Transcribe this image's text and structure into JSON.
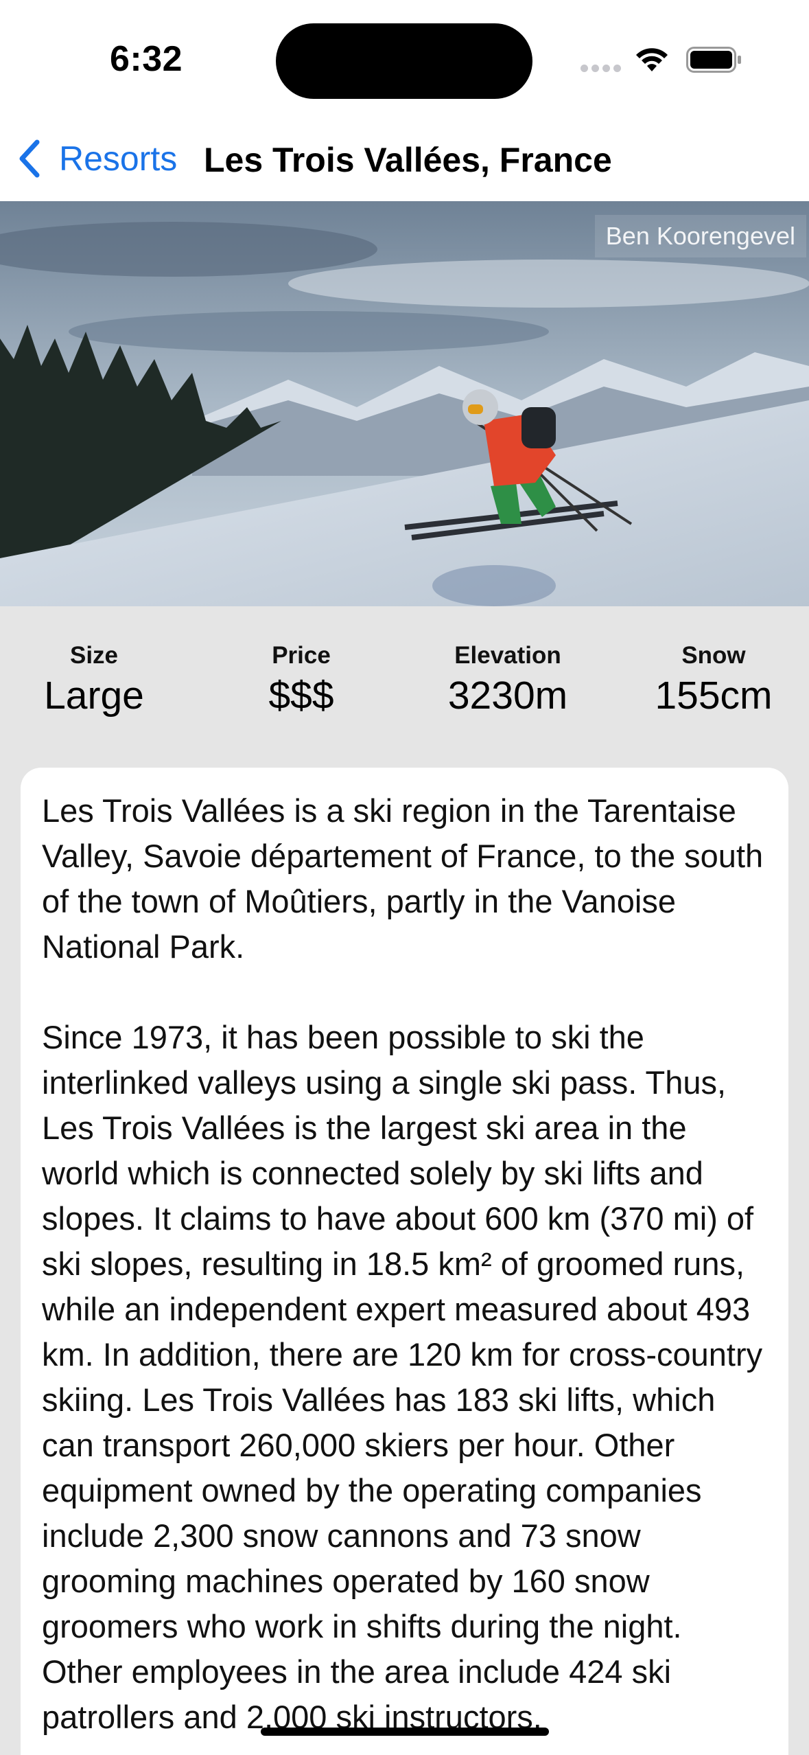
{
  "status_bar": {
    "time": "6:32",
    "icons": [
      "signal-icon",
      "wifi-icon",
      "battery-icon"
    ]
  },
  "nav": {
    "back_label": "Resorts",
    "back_icon": "chevron-left-icon",
    "title": "Les Trois Vallées, France",
    "accent_color": "#1a73e8"
  },
  "hero": {
    "photo_credit": "Ben Koorengevel"
  },
  "stats": [
    {
      "label": "Size",
      "value": "Large"
    },
    {
      "label": "Price",
      "value": "$$$"
    },
    {
      "label": "Elevation",
      "value": "3230m"
    },
    {
      "label": "Snow",
      "value": "155cm"
    }
  ],
  "description": {
    "paragraphs": [
      "Les Trois Vallées is a ski region in the Tarentaise Valley, Savoie département of France, to the south of the town of Moûtiers, partly in the Vanoise National Park.",
      "Since 1973, it has been possible to ski the interlinked valleys using a single ski pass. Thus, Les Trois Vallées is the largest ski area in the world which is connected solely by ski lifts and slopes. It claims to have about 600 km (370 mi) of ski slopes, resulting in 18.5 km² of groomed runs, while an independent expert measured about 493 km. In addition, there are 120 km for cross-country skiing. Les Trois Vallées has 183 ski lifts, which can transport 260,000 skiers per hour. Other equipment owned by the operating companies include 2,300 snow cannons and 73 snow grooming machines operated by 160 snow groomers who work in shifts during the night. Other employees in the area include 424 ski patrollers and 2,000 ski instructors."
    ]
  }
}
